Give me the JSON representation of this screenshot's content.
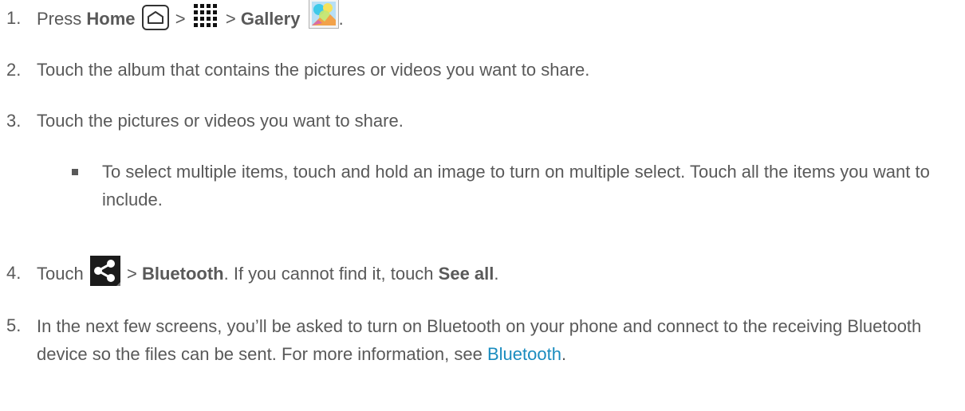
{
  "steps": [
    {
      "number": "1.",
      "press": "Press",
      "home": "Home",
      "sep1": ">",
      "sep2": ">",
      "gallery": "Gallery",
      "end": "."
    },
    {
      "number": "2.",
      "text": "Touch the album that contains the pictures or videos you want to share."
    },
    {
      "number": "3.",
      "text": "Touch the pictures or videos you want to share."
    },
    {
      "number": "4.",
      "touch": "Touch",
      "sep": ">",
      "bluetooth": "Bluetooth",
      "middle": ". If you cannot find it, touch",
      "see_all": "See all",
      "end": "."
    },
    {
      "number": "5.",
      "text": "In the next few screens, you’ll be asked to turn on Bluetooth on your phone and connect to the receiving Bluetooth device so the files can be sent. For more information, see",
      "link": "Bluetooth",
      "end": "."
    }
  ],
  "bullet": {
    "text": "To select multiple items, touch and hold an image to turn on multiple select. Touch all the items you want to include."
  },
  "icons": {
    "home": "home-button-icon",
    "apps": "apps-grid-icon",
    "gallery": "gallery-app-icon",
    "share": "share-icon"
  },
  "colors": {
    "text": "#595959",
    "link": "#1a8cbf"
  }
}
